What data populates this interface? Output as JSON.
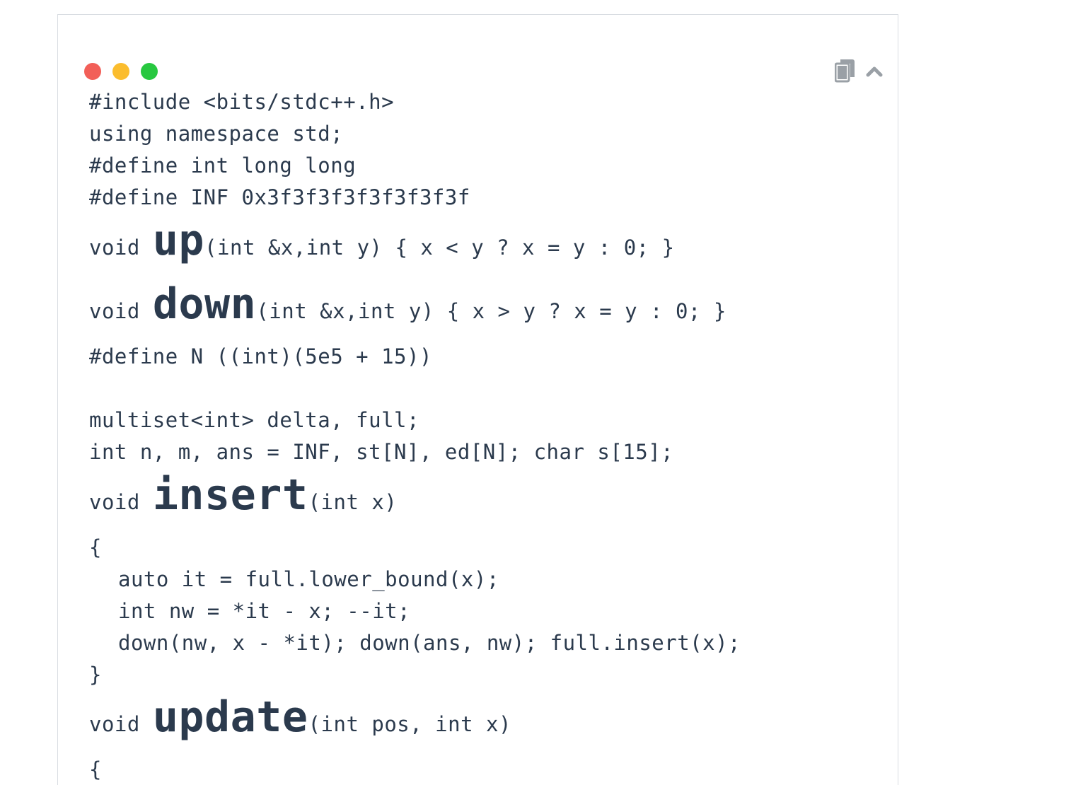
{
  "window": {
    "traffic_lights": [
      {
        "name": "close",
        "color": "#f25f58"
      },
      {
        "name": "minimize",
        "color": "#fbbd2e"
      },
      {
        "name": "zoom",
        "color": "#28c840"
      }
    ],
    "toolbar": {
      "copy_icon": "copy-icon",
      "collapse_icon": "chevron-up-icon",
      "icon_color": "#9aa0a6"
    }
  },
  "code": {
    "l1": "#include <bits/stdc++.h>",
    "l2": "using namespace std;",
    "l3": "#define int long long",
    "l4": "#define INF 0x3f3f3f3f3f3f3f3f",
    "up_pre": "void ",
    "up_name": "up",
    "up_post": "(int &x,int y) { x < y ? x = y : 0; }",
    "down_pre": "void ",
    "down_name": "down",
    "down_post": "(int &x,int y) { x > y ? x = y : 0; }",
    "l7": "#define N ((int)(5e5 + 15))",
    "l8": "multiset<int> delta, full;",
    "l9": "int n, m, ans = INF, st[N], ed[N]; char s[15];",
    "insert_pre": "void ",
    "insert_name": "insert",
    "insert_post": "(int x)",
    "open_brace": "{",
    "b1": "auto it = full.lower_bound(x);",
    "b2": "int nw = *it - x; --it;",
    "b3": "down(nw, x - *it); down(ans, nw); full.insert(x);",
    "close_brace": "}",
    "update_pre": "void ",
    "update_name": "update",
    "update_post": "(int pos, int x)",
    "open_brace2": "{"
  }
}
